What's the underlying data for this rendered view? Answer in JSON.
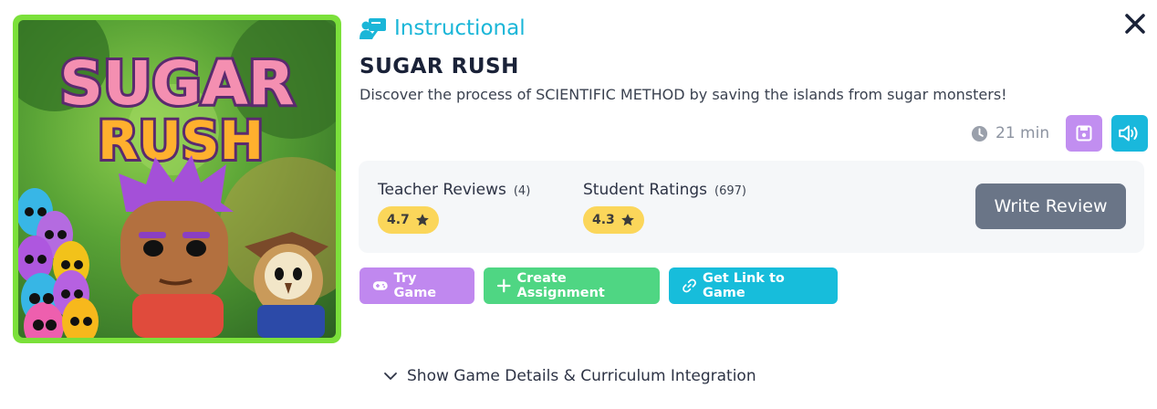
{
  "game": {
    "category": "Instructional",
    "title": "SUGAR RUSH",
    "description": "Discover the process of SCIENTIFIC METHOD by saving the islands from sugar monsters!",
    "duration": "21 min",
    "thumbnail_logo_line1": "SUGAR",
    "thumbnail_logo_line2": "RUSH"
  },
  "reviews": {
    "teacher_label": "Teacher Reviews",
    "teacher_count": "(4)",
    "teacher_rating": "4.7",
    "student_label": "Student Ratings",
    "student_count": "(697)",
    "student_rating": "4.3",
    "write_review_label": "Write Review"
  },
  "actions": {
    "try_game": "Try Game",
    "create_assignment": "Create Assignment",
    "get_link": "Get Link to Game"
  },
  "details_toggle": "Show Game Details & Curriculum Integration",
  "colors": {
    "category": "#1ab6d8",
    "save_button": "#c18ef0",
    "sound_button": "#19b8dc",
    "try_game": "#c088ef",
    "create_assignment": "#4fd683",
    "get_link": "#17bddb",
    "rating_pill": "#fbd65a",
    "write_review": "#6a7587",
    "thumbnail_border": "#7be03a"
  },
  "icons": [
    "teacher-board-icon",
    "close-icon",
    "clock-icon",
    "save-icon",
    "sound-icon",
    "star-icon",
    "gamepad-icon",
    "plus-icon",
    "link-icon",
    "chevron-down-icon"
  ]
}
